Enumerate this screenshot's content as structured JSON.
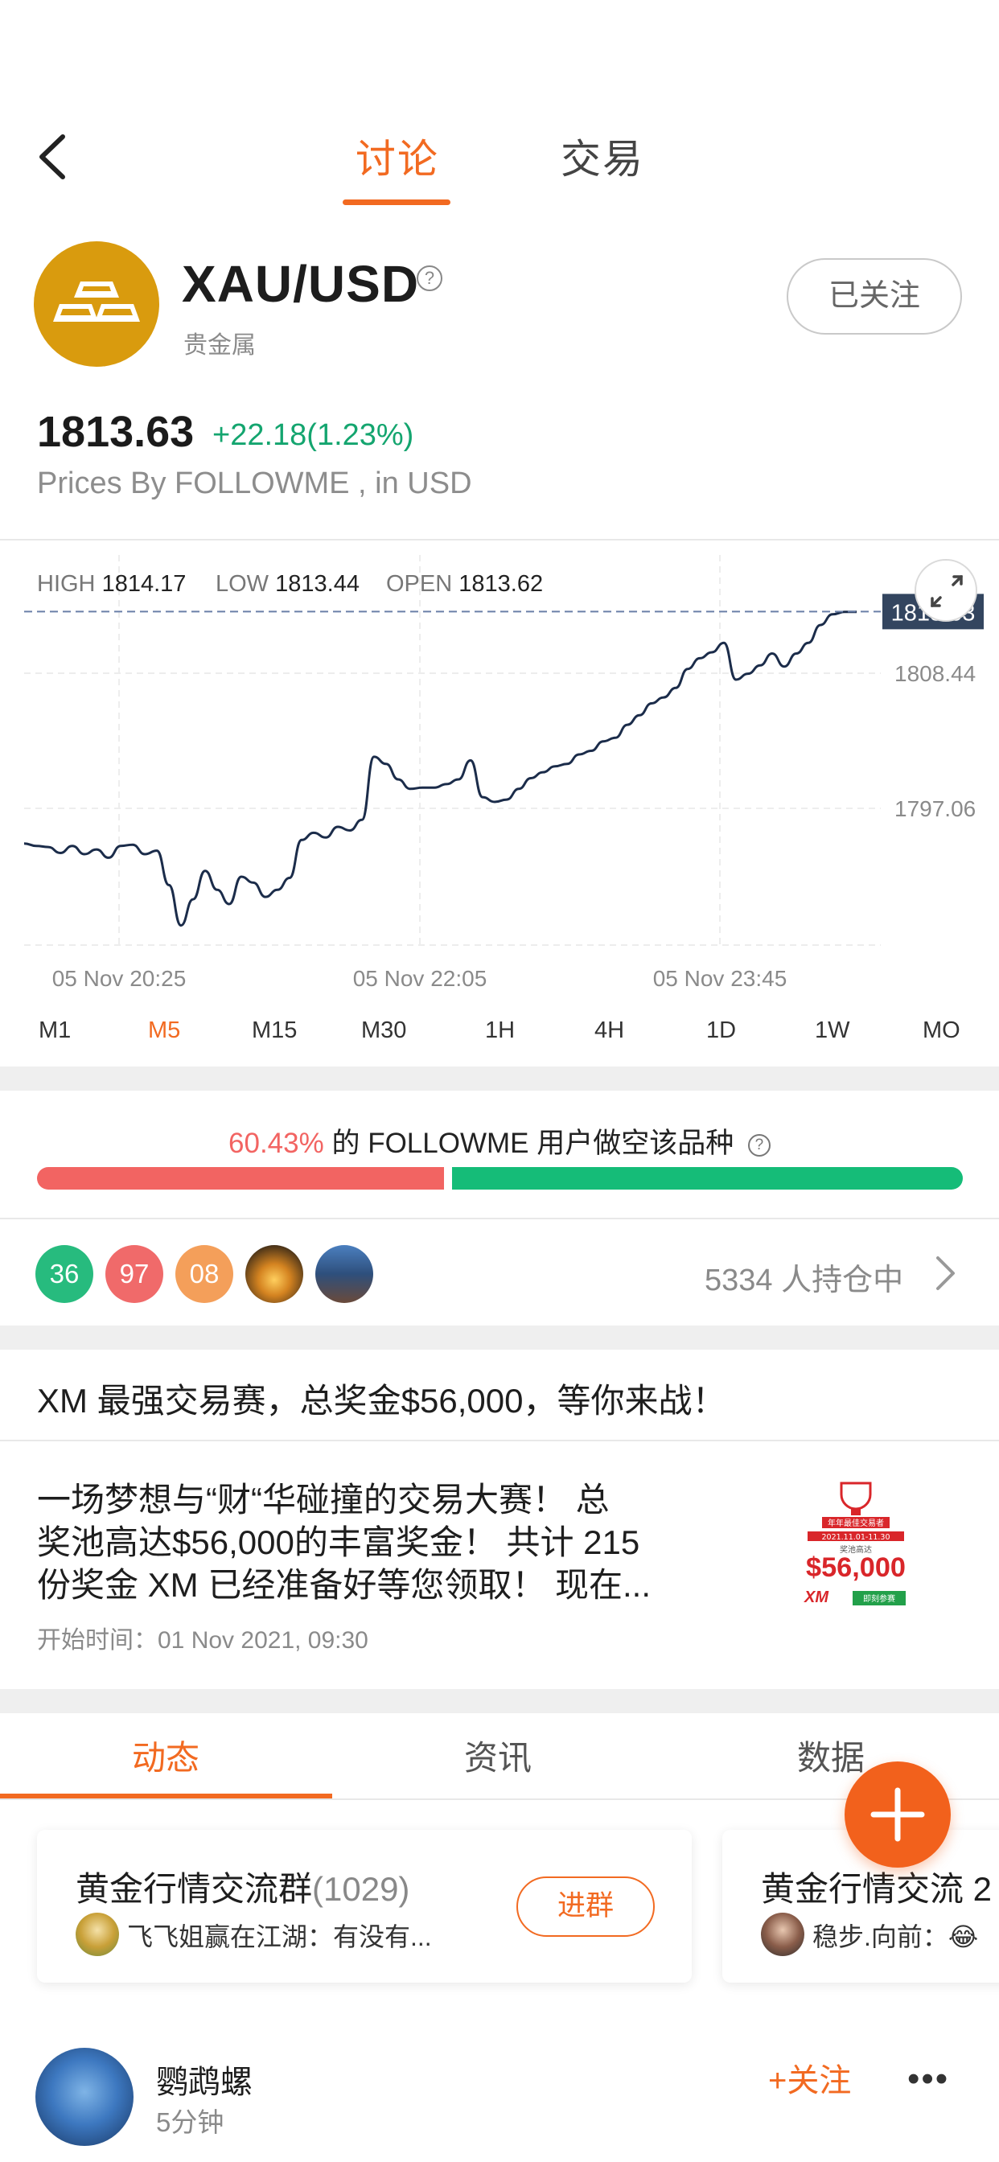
{
  "nav": {
    "tabs": [
      {
        "label": "讨论",
        "active": true
      },
      {
        "label": "交易",
        "active": false
      }
    ]
  },
  "asset": {
    "symbol": "XAU/USD",
    "category": "贵金属",
    "follow_label": "已关注",
    "price": "1813.63",
    "change": "+22.18(1.23%)",
    "price_source": "Prices By FOLLOWME , in USD"
  },
  "chart_data": {
    "type": "line",
    "high_label": "HIGH",
    "high": "1814.17",
    "low_label": "LOW",
    "low": "1813.44",
    "open_label": "OPEN",
    "open": "1813.62",
    "current_price_tag": "1813.63",
    "y_ticks": [
      "1808.44",
      "1797.06"
    ],
    "x_ticks": [
      "05 Nov 20:25",
      "05 Nov 22:05",
      "05 Nov 23:45"
    ],
    "series": [
      {
        "values": [
          1794.1,
          1793.9,
          1793.8,
          1793.3,
          1793.9,
          1793.2,
          1793.6,
          1792.9,
          1793.9,
          1794.0,
          1793.2,
          1793.5,
          1790.6,
          1787.2,
          1789.4,
          1791.8,
          1790.2,
          1789.0,
          1791.3,
          1790.8,
          1789.6,
          1790.2,
          1791.2,
          1794.4,
          1795.0,
          1794.6,
          1795.5,
          1795.2,
          1796.1,
          1801.4,
          1800.8,
          1799.5,
          1798.7,
          1798.8,
          1798.8,
          1799.1,
          1799.5,
          1801.1,
          1798.0,
          1797.6,
          1797.8,
          1798.7,
          1799.6,
          1800.1,
          1800.6,
          1800.8,
          1801.6,
          1801.9,
          1802.7,
          1803.0,
          1804.1,
          1804.9,
          1805.9,
          1806.4,
          1807.2,
          1808.8,
          1809.7,
          1810.2,
          1811.0,
          1807.9,
          1808.4,
          1809.1,
          1810.1,
          1809.0,
          1810.1,
          1811.0,
          1812.5,
          1813.4,
          1813.6,
          1813.6
        ]
      }
    ]
  },
  "timeframes": [
    {
      "label": "M1",
      "active": false
    },
    {
      "label": "M5",
      "active": true
    },
    {
      "label": "M15",
      "active": false
    },
    {
      "label": "M30",
      "active": false
    },
    {
      "label": "1H",
      "active": false
    },
    {
      "label": "4H",
      "active": false
    },
    {
      "label": "1D",
      "active": false
    },
    {
      "label": "1W",
      "active": false
    },
    {
      "label": "MO",
      "active": false
    }
  ],
  "sentiment": {
    "percent": "60.43%",
    "text": "的 FOLLOWME 用户做空该品种",
    "short_fraction": 0.4396
  },
  "holders": {
    "avatars": [
      "36",
      "97",
      "08"
    ],
    "count_text": "5334 人持仓中"
  },
  "promo": {
    "title": "XM 最强交易赛，总奖金$56,000，等你来战！",
    "body_lines": [
      "一场梦想与“财“华碰撞的交易大赛！ 总",
      "奖池高达$56,000的丰富奖金！ 共计 215",
      "份奖金 XM 已经准备好等您领取！ 现在..."
    ],
    "start_time": "开始时间：01 Nov 2021, 09:30",
    "image": {
      "header": "年年最佳交易者",
      "date": "2021.11.01-11.30",
      "sub": "奖池高达",
      "amount": "$56,000",
      "logo": "XM",
      "cta": "即刻参赛"
    }
  },
  "bottom_tabs": [
    {
      "label": "动态",
      "active": true
    },
    {
      "label": "资讯",
      "active": false
    },
    {
      "label": "数据",
      "active": false
    }
  ],
  "groups": [
    {
      "name": "黄金行情交流群",
      "count": "(1029)",
      "join_label": "进群",
      "last_message": "飞飞姐赢在江湖：有没有..."
    },
    {
      "name": "黄金行情交流 2",
      "last_message": "稳步.向前：😂"
    }
  ],
  "post": {
    "username": "鹦鹉螺",
    "time": "5分钟",
    "follow_label": "+关注",
    "more": "•••"
  }
}
